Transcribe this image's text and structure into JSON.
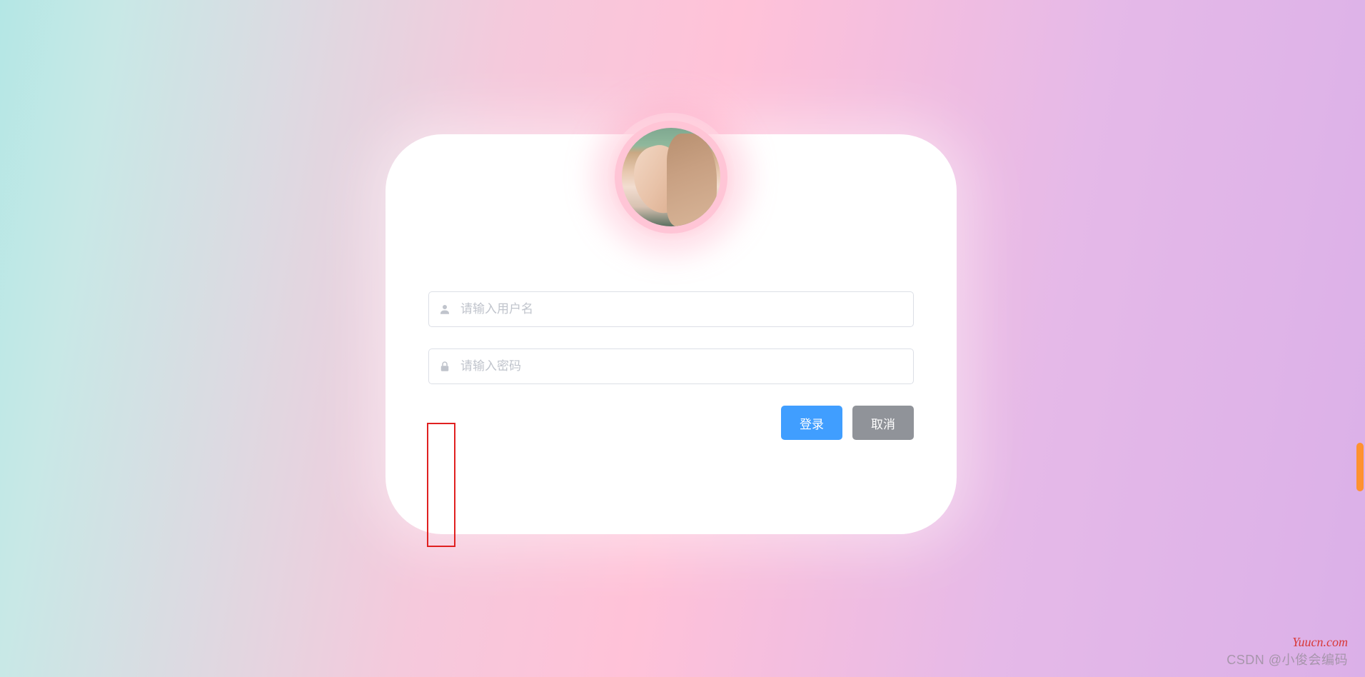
{
  "form": {
    "username": {
      "placeholder": "请输入用户名",
      "value": ""
    },
    "password": {
      "placeholder": "请输入密码",
      "value": ""
    }
  },
  "buttons": {
    "submit": "登录",
    "cancel": "取消"
  },
  "watermarks": {
    "site": "Yuucn.com",
    "csdn": "CSDN @小俊会编码"
  },
  "icons": {
    "user": "user-icon",
    "lock": "lock-icon"
  },
  "colors": {
    "primary": "#409eff",
    "secondary": "#909399",
    "highlight": "#e02020",
    "placeholder": "#c0c4cc"
  }
}
